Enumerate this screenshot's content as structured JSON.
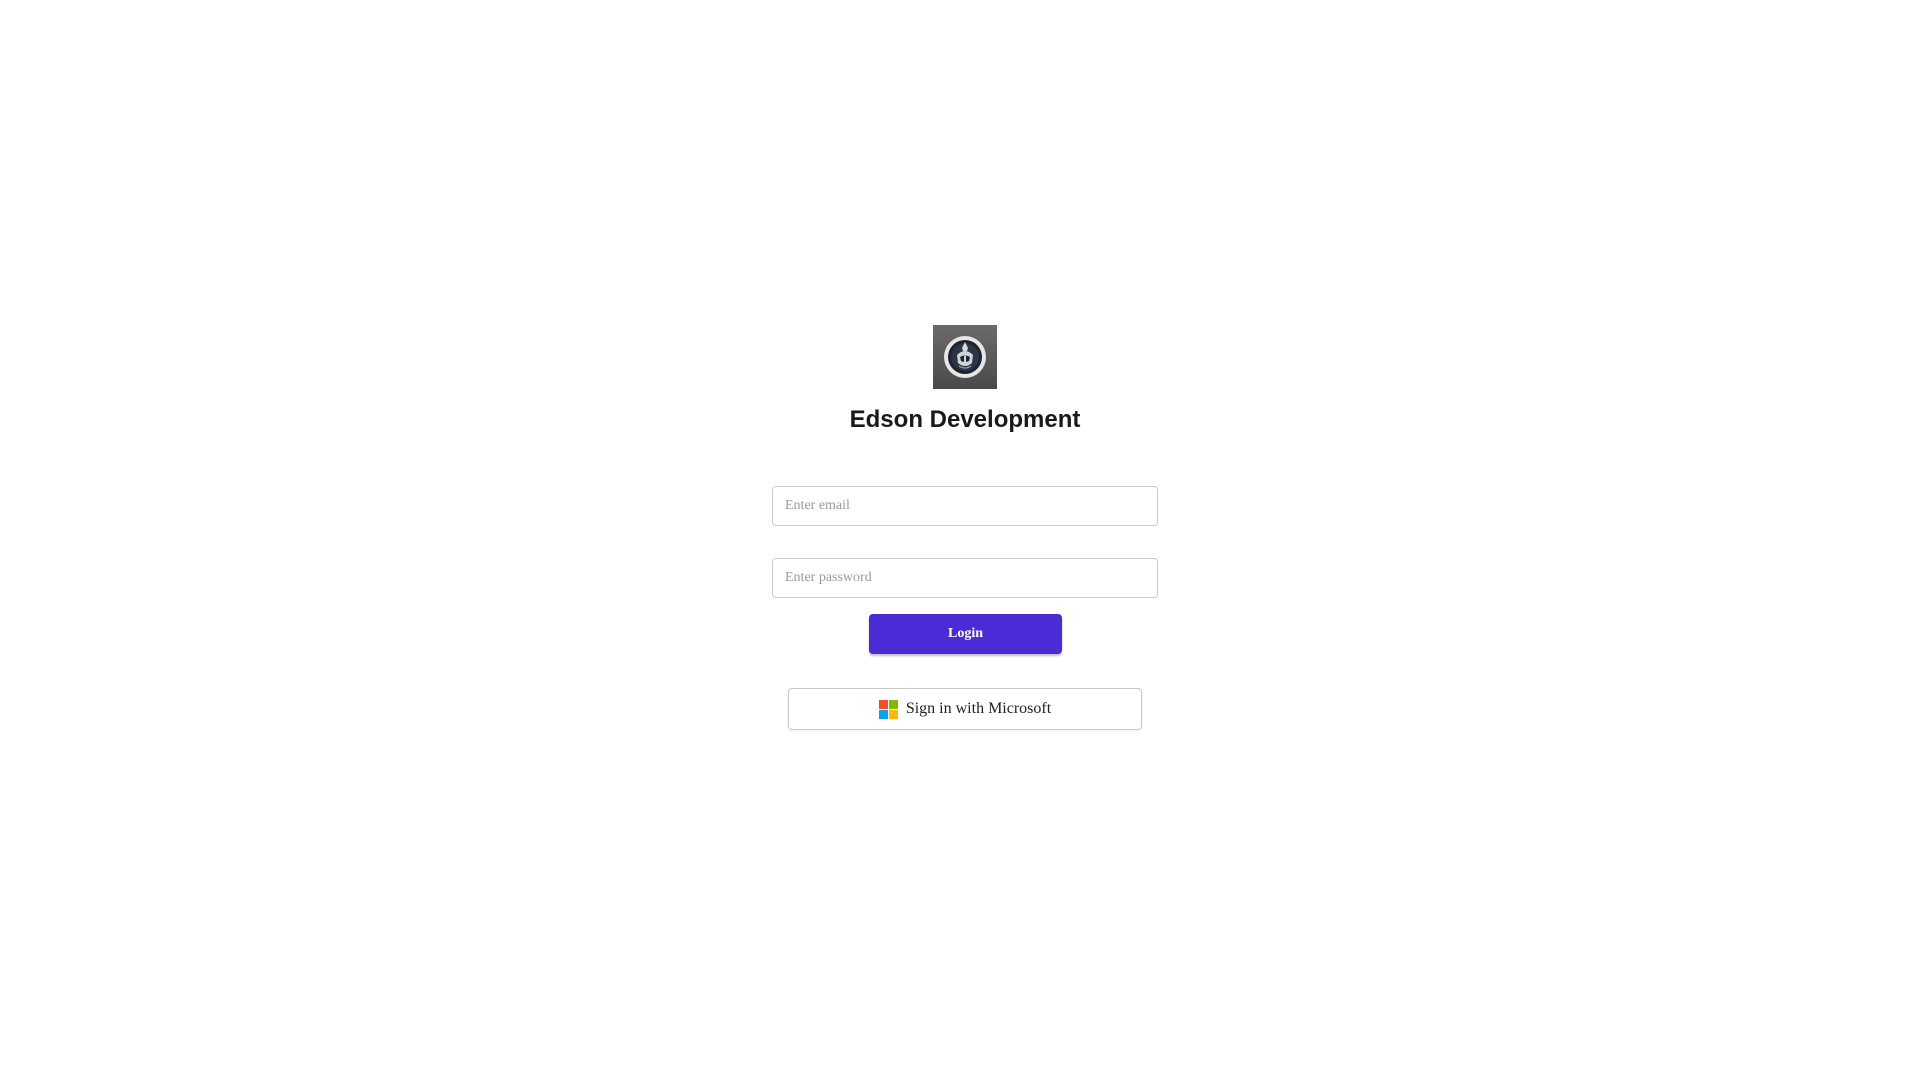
{
  "app": {
    "title": "Edson Development",
    "logo_icon": "helmet-emblem-icon"
  },
  "form": {
    "email_placeholder": "Enter email",
    "email_value": "",
    "password_placeholder": "Enter password",
    "password_value": "",
    "login_label": "Login"
  },
  "sso": {
    "microsoft_label": "Sign in with Microsoft",
    "microsoft_icon": "microsoft-logo-icon"
  },
  "colors": {
    "primary": "#4a2bd6",
    "ms_red": "#f25022",
    "ms_green": "#7fba00",
    "ms_blue": "#00a4ef",
    "ms_yellow": "#ffb900"
  }
}
